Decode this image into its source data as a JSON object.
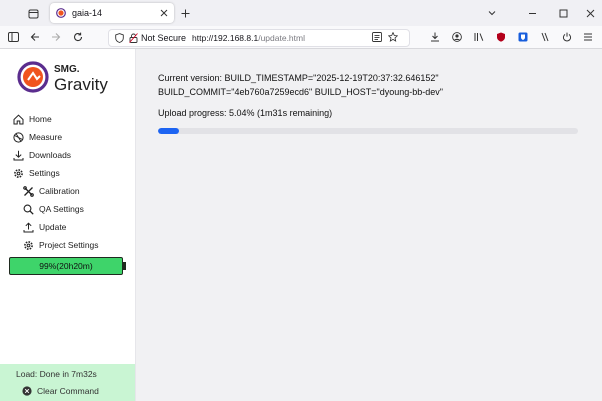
{
  "browser": {
    "tab_title": "gaia-14",
    "security_label": "Not Secure",
    "url_host": "http://192.168.8.1",
    "url_path": "/update.html",
    "icons": [
      "tab-list-icon",
      "new-tab-icon",
      "back-icon",
      "forward-icon",
      "reload-icon",
      "shield-icon",
      "lock-broken-icon",
      "reader-icon",
      "star-icon",
      "downloads-icon",
      "account-icon",
      "library-icon",
      "extension-icon",
      "menu-icon"
    ]
  },
  "sidebar": {
    "logo_brand": "SMG.",
    "logo_name": "Gravity",
    "items": [
      {
        "label": "Home",
        "icon": "home-icon"
      },
      {
        "label": "Measure",
        "icon": "measure-icon"
      },
      {
        "label": "Downloads",
        "icon": "download-icon"
      },
      {
        "label": "Settings",
        "icon": "gear-icon"
      }
    ],
    "sub_items": [
      {
        "label": "Calibration",
        "icon": "tools-icon"
      },
      {
        "label": "QA Settings",
        "icon": "magnifier-icon"
      },
      {
        "label": "Update",
        "icon": "upload-icon"
      },
      {
        "label": "Project Settings",
        "icon": "gear-icon"
      }
    ],
    "battery_label": "99%(20h20m)",
    "battery_level": 0.99,
    "load_status": "Load: Done in 7m32s",
    "clear_command_label": "Clear Command"
  },
  "main": {
    "version_line": "Current version: BUILD_TIMESTAMP=\"2025-12-19T20:37:32.646152\" BUILD_COMMIT=\"4eb760a7259ecd6\" BUILD_HOST=\"dyoung-bb-dev\"",
    "progress_label": "Upload progress: 5.04% (1m31s remaining)",
    "progress_value": 0.0504
  },
  "colors": {
    "accent": "#1d64f2",
    "battery": "#3ed46a",
    "footer": "#c9f5d3",
    "logo_orange": "#f0541e",
    "logo_purple": "#5b2d8e"
  }
}
